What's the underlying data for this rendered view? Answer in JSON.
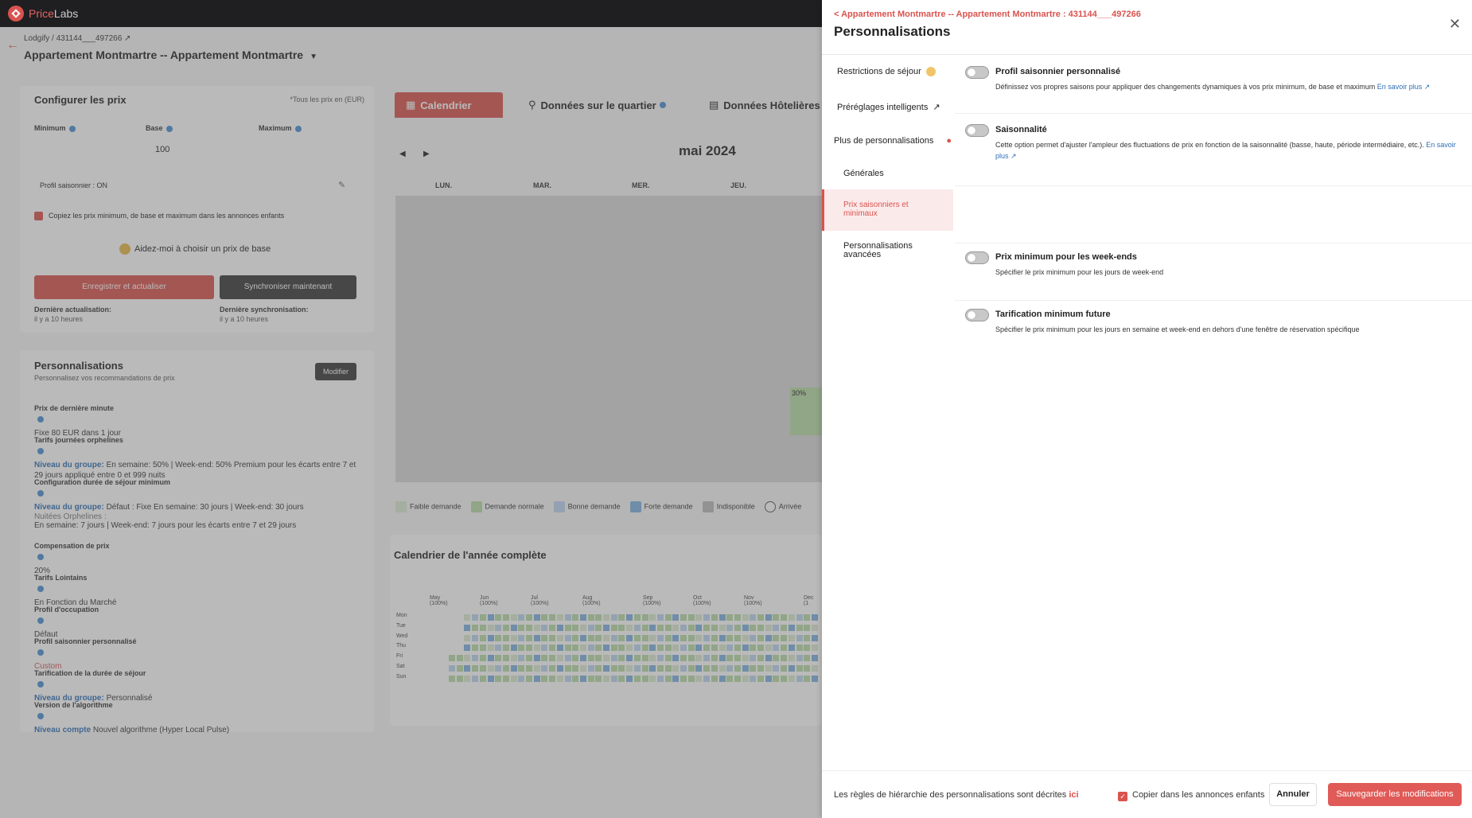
{
  "brand": {
    "price": "Price",
    "labs": "Labs"
  },
  "listing": {
    "crumb": "Lodgify / 431144___497266",
    "title": "Appartement Montmartre -- Appartement Montmartre"
  },
  "prices": {
    "title": "Configurer les prix",
    "currency_note": "*Tous les prix en (EUR)",
    "min_label": "Minimum",
    "base_label": "Base",
    "max_label": "Maximum",
    "base_value": "100",
    "seasonal_profile": "Profil saisonnier : ON",
    "copy_label": "Copiez les prix minimum, de base et maximum dans les annonces enfants",
    "help_label": "Aidez-moi à choisir un prix de base",
    "save_btn": "Enregistrer et actualiser",
    "sync_btn": "Synchroniser maintenant",
    "last_update_label": "Dernière actualisation:",
    "last_update_value": "il y a 10 heures",
    "last_sync_label": "Dernière synchronisation:",
    "last_sync_value": "il y a 10 heures"
  },
  "custom": {
    "title": "Personnalisations",
    "subtitle": "Personnalisez vos recommandations de prix",
    "edit_btn": "Modifier",
    "items": [
      {
        "label": "Prix de dernière minute",
        "value": "Fixe 80 EUR dans 1 jour"
      },
      {
        "label": "Tarifs journées orphelines",
        "prefix": "Niveau du groupe:",
        "value": "En semaine: 50% | Week-end: 50% Premium pour les écarts entre 7 et 29 jours appliqué entre 0 et 999 nuits"
      },
      {
        "label": "Configuration durée de séjour minimum",
        "prefix": "Niveau du groupe:",
        "value": "Défaut : Fixe En semaine: 30 jours | Week-end: 30 jours",
        "extra_label": "Nuitées Orphelines :",
        "extra_value": "En semaine: 7 jours | Week-end: 7 jours pour les écarts entre 7 et 29 jours"
      },
      {
        "label": "Compensation de prix",
        "value": "20%"
      },
      {
        "label": "Tarifs Lointains",
        "value": "En Fonction du Marché"
      },
      {
        "label": "Profil d'occupation",
        "value": "Défaut"
      },
      {
        "label": "Profil saisonnier personnalisé",
        "value": "Custom"
      },
      {
        "label": "Tarification de la durée de séjour",
        "prefix": "Niveau du groupe:",
        "value": "Personnalisé"
      },
      {
        "label": "Version de l'algorithme",
        "prefix": "Niveau compte",
        "value": "Nouvel algorithme (Hyper Local Pulse)"
      }
    ]
  },
  "tabs": {
    "calendar": "Calendrier",
    "neighborhood": "Données sur le quartier",
    "hotel": "Données Hôtelières"
  },
  "calendar": {
    "month": "mai 2024",
    "days": [
      "LUN.",
      "MAR.",
      "MER.",
      "JEU."
    ],
    "cell_value": "30%",
    "legend": [
      "Faible demande",
      "Demande normale",
      "Bonne demande",
      "Forte demande",
      "Indisponible",
      "Arrivée"
    ],
    "year_title": "Calendrier de l'année complète",
    "months": [
      "May (100%)",
      "Jun (100%)",
      "Jul (100%)",
      "Aug (100%)",
      "Sep (100%)",
      "Oct (100%)",
      "Nov (100%)",
      "Dec (1"
    ],
    "weekdays": [
      "Mon",
      "Tue",
      "Wed",
      "Thu",
      "Fri",
      "Sat",
      "Sun"
    ]
  },
  "panel": {
    "crumb": "< Appartement Montmartre -- Appartement Montmartre : 431144___497266",
    "title": "Personnalisations",
    "nav": {
      "restrictions": "Restrictions de séjour",
      "presets": "Préréglages intelligents",
      "more": "Plus de personnalisations",
      "general": "Générales",
      "seasonal": "Prix saisonniers et minimaux",
      "advanced": "Personnalisations avancées"
    },
    "rows": [
      {
        "title": "Profil saisonnier personnalisé",
        "desc": "Définissez vos propres saisons pour appliquer des changements dynamiques à vos prix minimum, de base et maximum",
        "link": "En savoir plus"
      },
      {
        "title": "Saisonnalité",
        "desc": "Cette option permet d'ajuster l'ampleur des fluctuations de prix en fonction de la saisonnalité (basse, haute, période intermédiaire, etc.).",
        "link": "En savoir plus"
      },
      {
        "title": "Prix minimum pour les week-ends",
        "desc": "Spécifier le prix minimum pour les jours de week-end"
      },
      {
        "title": "Tarification minimum future",
        "desc": "Spécifier le prix minimum pour les jours en semaine et week-end en dehors d'une fenêtre de réservation spécifique"
      }
    ],
    "footer": {
      "rules_text": "Les règles de hiérarchie des personnalisations sont décrites",
      "rules_link": "ici",
      "copy_label": "Copier dans les annonces enfants",
      "cancel": "Annuler",
      "save": "Sauvegarder les modifications"
    }
  },
  "colors": {
    "accent": "#d9534f",
    "link": "#2d6fb5"
  }
}
